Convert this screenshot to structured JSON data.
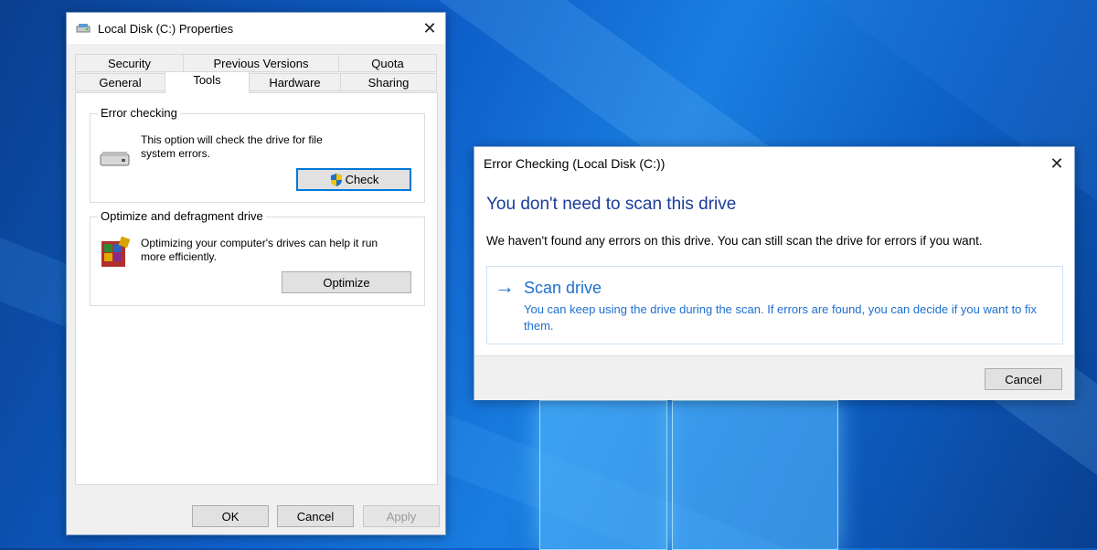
{
  "desktop": {
    "wallpaper": "windows-10-default",
    "accent": "#0e5fc9"
  },
  "properties_dialog": {
    "title": "Local Disk (C:) Properties",
    "close_glyph": "✕",
    "tabs_row1": [
      "Security",
      "Previous Versions",
      "Quota"
    ],
    "tabs_row2": [
      "General",
      "Tools",
      "Hardware",
      "Sharing"
    ],
    "active_tab": "Tools",
    "error_checking": {
      "legend": "Error checking",
      "description_line1": "This option will check the drive for file",
      "description_line2": "system errors.",
      "button": "Check"
    },
    "optimize": {
      "legend": "Optimize and defragment drive",
      "description_line1": "Optimizing your computer's drives can help it run",
      "description_line2": "more efficiently.",
      "button": "Optimize"
    },
    "buttons": {
      "ok": "OK",
      "cancel": "Cancel",
      "apply": "Apply"
    }
  },
  "error_dialog": {
    "title": "Error Checking (Local Disk (C:))",
    "close_glyph": "✕",
    "heading": "You don't need to scan this drive",
    "message": "We haven't found any errors on this drive. You can still scan the drive for errors if you want.",
    "scan_link": {
      "arrow": "→",
      "title": "Scan drive",
      "note": "You can keep using the drive during the scan. If errors are found, you can decide if you want to fix them."
    },
    "cancel_button": "Cancel"
  }
}
